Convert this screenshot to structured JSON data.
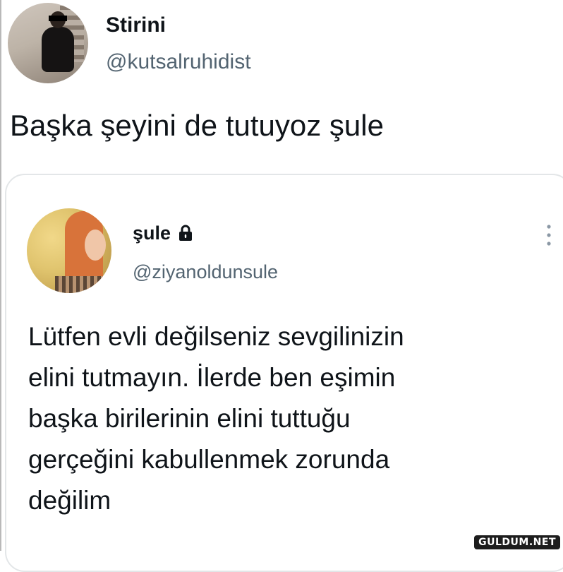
{
  "tweet": {
    "display_name": "Stirini",
    "handle": "@kutsalruhidist",
    "text": "Başka şeyini de tutuyoz şule"
  },
  "quoted_tweet": {
    "display_name": "şule",
    "protected_icon": "lock-icon",
    "handle": "@ziyanoldunsule",
    "more_icon": "more-vertical-icon",
    "text_lines": [
      "Lütfen evli değilseniz sevgilinizin",
      "elini tutmayın. İlerde ben eşimin",
      "başka birilerinin elini tuttuğu",
      "gerçeğini kabullenmek zorunda",
      "değilim"
    ]
  },
  "watermark": "GULDUM.NET",
  "colors": {
    "text_primary": "#0f1419",
    "text_secondary": "#536471",
    "card_border": "#e3e6e8"
  }
}
